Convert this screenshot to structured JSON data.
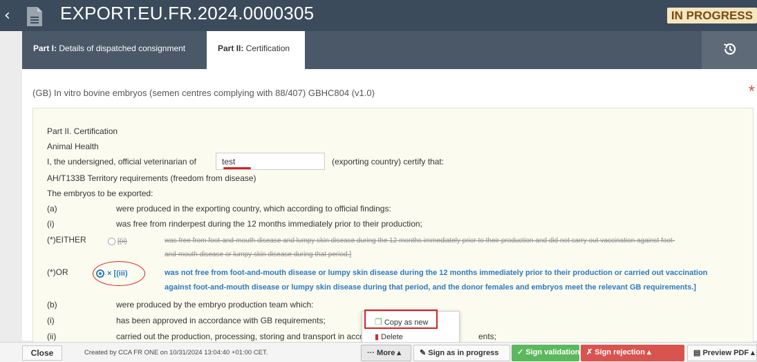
{
  "header": {
    "title": "EXPORT.EU.FR.2024.0000305",
    "status": "IN PROGRESS"
  },
  "tabs": [
    {
      "prefix": "Part I:",
      "label": " Details of dispatched consignment"
    },
    {
      "prefix": "Part II:",
      "label": " Certification"
    }
  ],
  "certificate": {
    "title": "(GB) In vitro bovine embryos (semen centres complying with 88/407) GBHC804 (v1.0)",
    "required_mark": "*"
  },
  "form": {
    "heading": "Part II. Certification",
    "section": "Animal Health",
    "vet_prefix": "I, the undersigned, official veterinarian of",
    "vet_value": "test",
    "vet_suffix": "(exporting country) certify that:",
    "territory": "AH/T133B Territory requirements (freedom from disease)",
    "embryos_intro": "The embryos to be exported:",
    "rows": [
      {
        "key": "(a)",
        "text": "were produced in the exporting country, which according to official findings:"
      },
      {
        "key": "(i)",
        "text": "was free from rinderpest during the 12 months immediately prior to their production;"
      }
    ],
    "either_key": "(*)EITHER",
    "either_code": "[(ii)",
    "either_line1": "was free from foot-and-mouth disease and lumpy skin disease during the 12 months immediately prior to their production and did not carry out vaccination against foot-",
    "either_line2": "and-mouth disease or lumpy skin disease during that period.]",
    "or_key": "(*)OR",
    "or_code": "× [(iii)",
    "or_line1": "was not free from foot-and-mouth disease or lumpy skin disease during the 12 months immediately prior to their production or carried out vaccination",
    "or_line2": "against foot-and-mouth disease or lumpy skin disease during that period, and the donor females and embryos meet the relevant GB requirements.]",
    "b_key": "(b)",
    "b_text": "were produced by the embryo production team which:",
    "bi_key": "(i)",
    "bi_text": "has been approved in accordance with GB requirements;",
    "bii_key": "(ii)",
    "bii_text_start": "carried out the production, processing, storing and transport in acco",
    "bii_text_end": "ents;"
  },
  "dropdown": {
    "copy": "Copy as new",
    "delete": "Delete"
  },
  "bottom": {
    "close": "Close",
    "created": "Created by CCA FR ONE on 10/31/2024 13:04:40 +01:00 CET.",
    "more": "··· More ▴",
    "sign_progress": "✎ Sign as in progress",
    "sign_validation": "✓ Sign validation ▴",
    "sign_rejection": "✗ Sign rejection ▴",
    "preview": "▤ Preview PDF ▴"
  },
  "colors": {
    "header_bg": "#3b4b5b",
    "status_badge_bg": "#f5e6c0",
    "validation_green": "#5cb85c",
    "rejection_red": "#d9534f",
    "link_blue": "#2b7bbf"
  }
}
